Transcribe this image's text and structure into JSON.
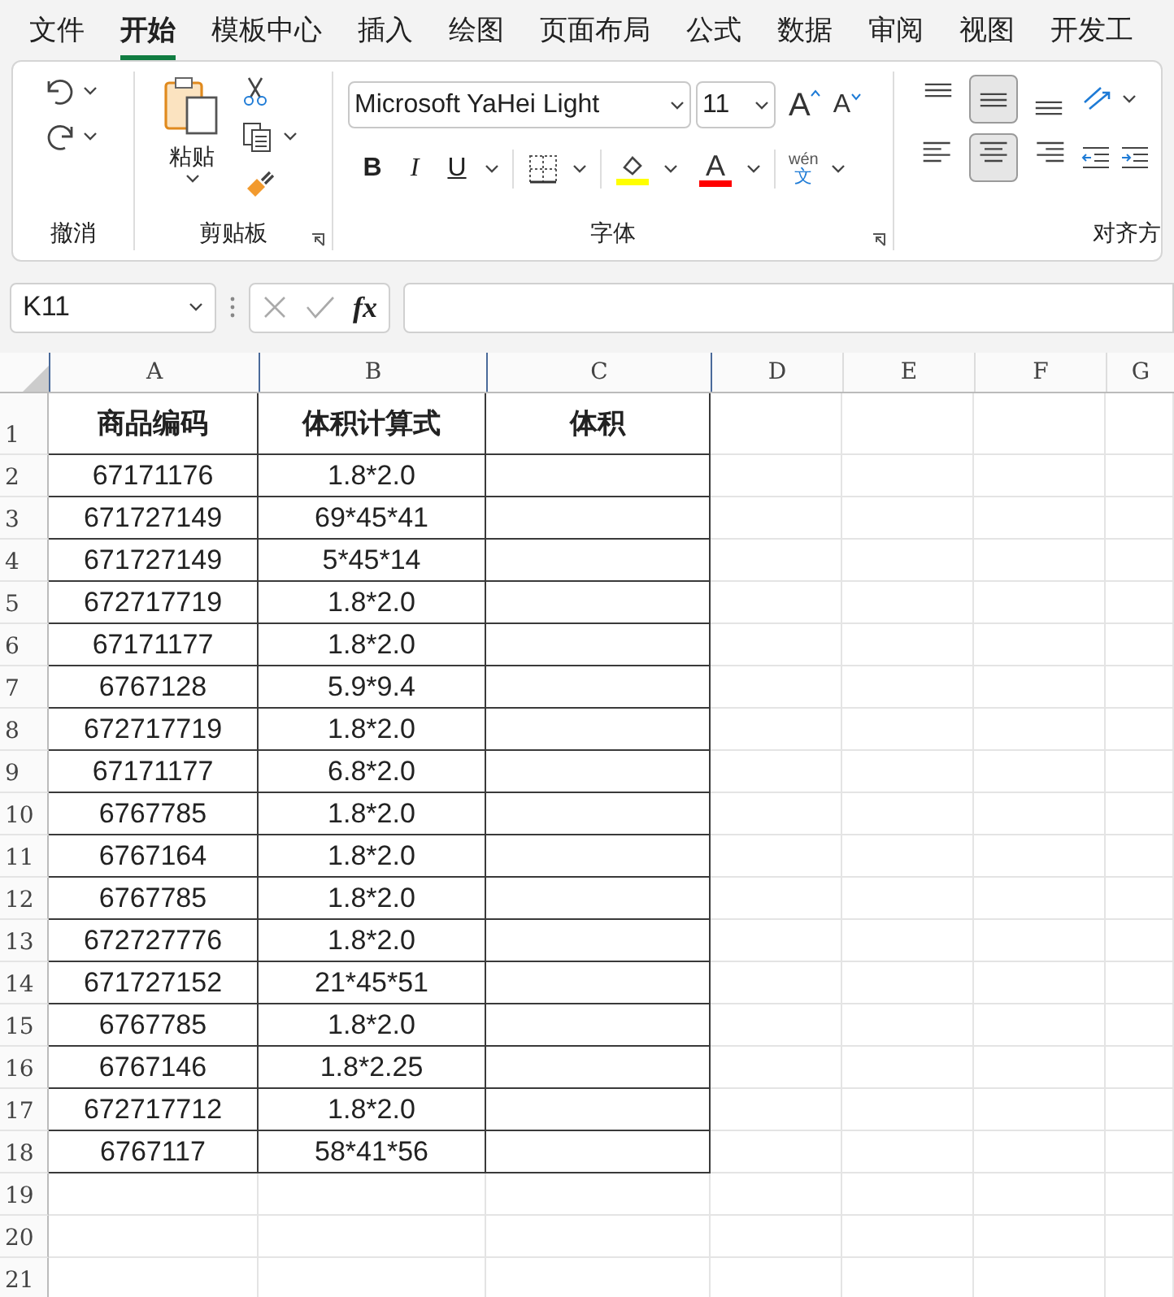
{
  "tabs": [
    {
      "label": "文件",
      "selected": false
    },
    {
      "label": "开始",
      "selected": true
    },
    {
      "label": "模板中心",
      "selected": false
    },
    {
      "label": "插入",
      "selected": false
    },
    {
      "label": "绘图",
      "selected": false
    },
    {
      "label": "页面布局",
      "selected": false
    },
    {
      "label": "公式",
      "selected": false
    },
    {
      "label": "数据",
      "selected": false
    },
    {
      "label": "审阅",
      "selected": false
    },
    {
      "label": "视图",
      "selected": false
    },
    {
      "label": "开发工",
      "selected": false
    }
  ],
  "ribbon": {
    "groups": [
      {
        "label": "撤消"
      },
      {
        "label": "剪贴板"
      },
      {
        "label": "字体"
      },
      {
        "label": "对齐方"
      }
    ],
    "paste_label": "粘贴",
    "font_name": "Microsoft YaHei Light",
    "font_size": "11",
    "grow_letter": "A",
    "shrink_letter": "A",
    "bold_letter": "B",
    "italic_letter": "I",
    "underline_letter": "U",
    "font_color_letter": "A",
    "phonetic_top": "wén",
    "phonetic_bottom": "文",
    "vertical_align": [
      {
        "selected": false
      },
      {
        "selected": true
      },
      {
        "selected": false
      }
    ],
    "horizontal_align": [
      {
        "selected": false
      },
      {
        "selected": true
      },
      {
        "selected": false
      }
    ]
  },
  "formula_bar": {
    "name_box": "K11",
    "fx": "fx"
  },
  "sheet": {
    "columns": [
      "A",
      "B",
      "C",
      "D",
      "E",
      "F",
      "G"
    ],
    "row_numbers": [
      "1",
      "2",
      "3",
      "4",
      "5",
      "6",
      "7",
      "8",
      "9",
      "10",
      "11",
      "12",
      "13",
      "14",
      "15",
      "16",
      "17",
      "18",
      "19",
      "20",
      "21"
    ],
    "header": [
      "商品编码",
      "体积计算式",
      "体积"
    ],
    "rows": [
      [
        "67171176",
        "1.8*2.0",
        ""
      ],
      [
        "671727149",
        "69*45*41",
        ""
      ],
      [
        "671727149",
        "5*45*14",
        ""
      ],
      [
        "672717719",
        "1.8*2.0",
        ""
      ],
      [
        "67171177",
        "1.8*2.0",
        ""
      ],
      [
        "6767128",
        "5.9*9.4",
        ""
      ],
      [
        "672717719",
        "1.8*2.0",
        ""
      ],
      [
        "67171177",
        "6.8*2.0",
        ""
      ],
      [
        "6767785",
        "1.8*2.0",
        ""
      ],
      [
        "6767164",
        "1.8*2.0",
        ""
      ],
      [
        "6767785",
        "1.8*2.0",
        ""
      ],
      [
        "672727776",
        "1.8*2.0",
        ""
      ],
      [
        "671727152",
        "21*45*51",
        ""
      ],
      [
        "6767785",
        "1.8*2.0",
        ""
      ],
      [
        "6767146",
        "1.8*2.25",
        ""
      ],
      [
        "672717712",
        "1.8*2.0",
        ""
      ],
      [
        "6767117",
        "58*41*56",
        ""
      ]
    ]
  }
}
